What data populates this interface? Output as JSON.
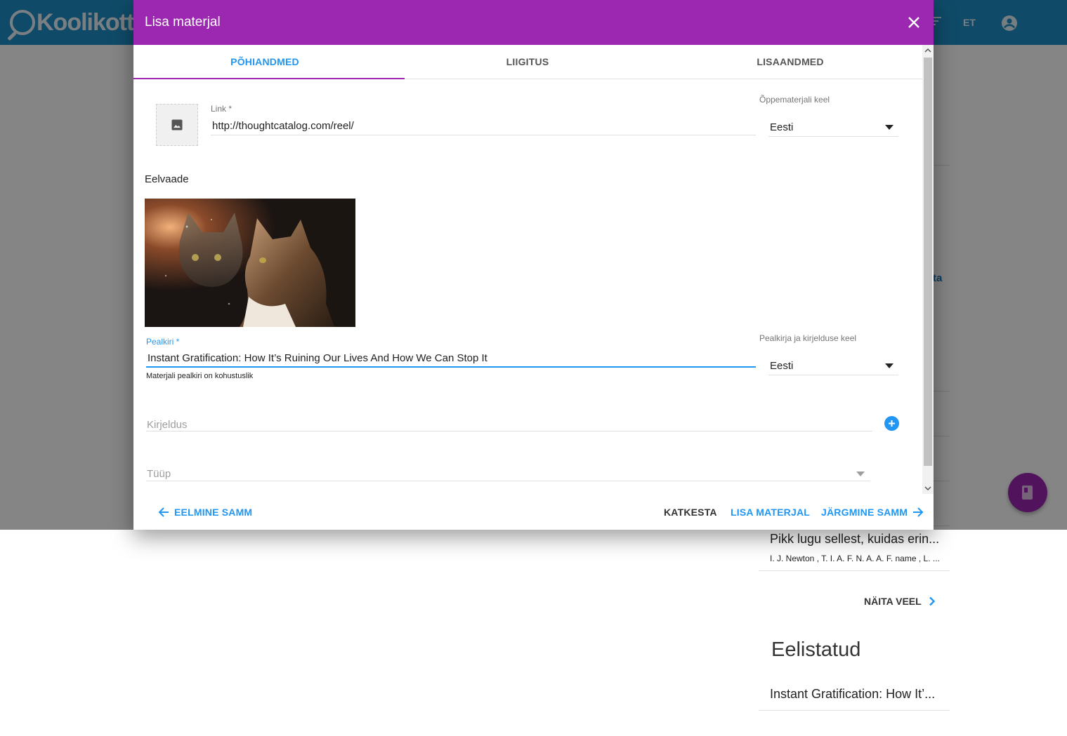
{
  "app": {
    "logo_text": "Koolikott",
    "language": "ET"
  },
  "sidebar": {
    "partial_link": "ta",
    "recent_item": {
      "title": "Pikk lugu sellest, kuidas erin...",
      "authors": "I. J. Newton , T. I. A. F. N. A. A. F. name , L. ..."
    },
    "show_more_label": "NÄITA VEEL",
    "featured_heading": "Eelistatud",
    "featured_item": {
      "title": "Instant Gratification: How It’..."
    }
  },
  "dialog": {
    "title": "Lisa materjal",
    "tabs": [
      {
        "label": "PÕHIANDMED",
        "active": true
      },
      {
        "label": "LIIGITUS",
        "active": false
      },
      {
        "label": "LISAANDMED",
        "active": false
      }
    ],
    "link": {
      "label": "Link *",
      "value": "http://thoughtcatalog.com/reel/"
    },
    "material_language": {
      "label": "Õppematerjali keel",
      "value": "Eesti"
    },
    "preview_heading": "Eelvaade",
    "title_field": {
      "label": "Pealkiri *",
      "value": "Instant Gratification: How It’s Ruining Our Lives And How We Can Stop It",
      "hint": "Materjali pealkiri on kohustuslik"
    },
    "title_language": {
      "label": "Pealkirja ja kirjelduse keel",
      "value": "Eesti"
    },
    "description": {
      "placeholder": "Kirjeldus"
    },
    "type": {
      "placeholder": "Tüüp"
    },
    "actions": {
      "previous": "EELMINE SAMM",
      "cancel": "KATKESTA",
      "add": "LISA MATERJAL",
      "next": "JÄRGMINE SAMM"
    }
  },
  "colors": {
    "header_blue": "#1e90c7",
    "dialog_purple": "#9c27b0",
    "accent_blue": "#2196f3"
  },
  "icons": {
    "close": "close-icon",
    "image": "image-icon",
    "add": "add-circle-icon",
    "arrow_back": "arrow-back-icon",
    "arrow_forward": "arrow-forward-icon",
    "account": "account-circle-icon",
    "chevron_right": "chevron-right-icon",
    "book": "book-icon"
  }
}
